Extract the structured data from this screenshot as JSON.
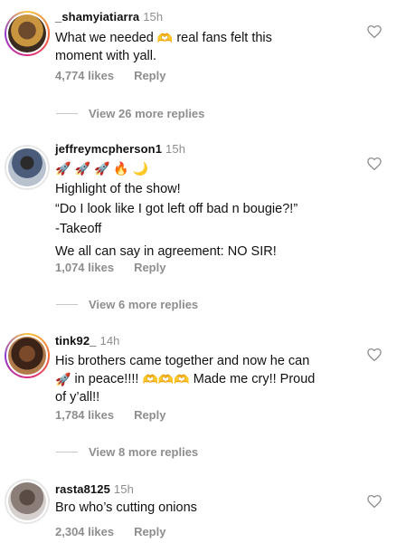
{
  "comments": [
    {
      "username": "_shamyiatiarra",
      "time": "15h",
      "lines": [
        "What we needed",
        "real fans felt this",
        "moment with yall."
      ],
      "likes": "4,774 likes",
      "reply": "Reply",
      "view_replies": "View 26 more replies"
    },
    {
      "username": "jeffreymcpherson1",
      "time": "15h",
      "lines": [
        "Highlight of the show!",
        "“Do I look like I got left off bad n bougie?!”",
        "-Takeoff",
        "We all can say in agreement: NO SIR!"
      ],
      "likes": "1,074 likes",
      "reply": "Reply",
      "view_replies": "View 6 more replies"
    },
    {
      "username": "tink92_",
      "time": "14h",
      "lines": [
        "His brothers came together and now he can",
        "in peace!!!!",
        "Made me cry!! Proud",
        "of y’all!!"
      ],
      "likes": "1,784 likes",
      "reply": "Reply",
      "view_replies": "View 8 more replies"
    },
    {
      "username": "rasta8125",
      "time": "15h",
      "lines": [
        "Bro who’s cutting onions"
      ],
      "likes": "2,304 likes",
      "reply": "Reply"
    }
  ],
  "icons": {
    "heart": "heart-outline-icon",
    "hands": "heart-hands-emoji",
    "rocket": "rocket-emoji",
    "fire": "fire-emoji",
    "moon": "crescent-moon-emoji"
  },
  "colors": {
    "text": "#111111",
    "muted": "#8e8e8e"
  }
}
